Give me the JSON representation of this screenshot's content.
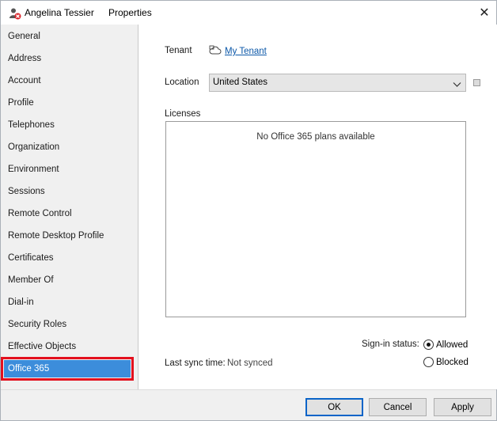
{
  "titlebar": {
    "user_name": "Angelina Tessier",
    "window_title": "Properties",
    "icon": "user-disabled-icon",
    "close_glyph": "✕"
  },
  "sidebar": {
    "items": [
      {
        "label": "General"
      },
      {
        "label": "Address"
      },
      {
        "label": "Account"
      },
      {
        "label": "Profile"
      },
      {
        "label": "Telephones"
      },
      {
        "label": "Organization"
      },
      {
        "label": "Environment"
      },
      {
        "label": "Sessions"
      },
      {
        "label": "Remote Control"
      },
      {
        "label": "Remote Desktop Profile"
      },
      {
        "label": "Certificates"
      },
      {
        "label": "Member Of"
      },
      {
        "label": "Dial-in"
      },
      {
        "label": "Security Roles"
      },
      {
        "label": "Effective Objects"
      },
      {
        "label": "Office 365"
      }
    ],
    "selected": "Office 365"
  },
  "main": {
    "tenant_label": "Tenant",
    "tenant_icon": "cloud-icon",
    "tenant_link": "My Tenant",
    "location_label": "Location",
    "location_value": "United States",
    "licenses_label": "Licenses",
    "licenses_empty": "No Office 365 plans available",
    "sign_in_label": "Sign-in status:",
    "sign_in_options": [
      {
        "label": "Allowed",
        "checked": true
      },
      {
        "label": "Blocked",
        "checked": false
      }
    ],
    "last_sync_label": "Last sync time:",
    "last_sync_value": "Not synced"
  },
  "footer": {
    "ok_label": "OK",
    "cancel_label": "Cancel",
    "apply_label": "Apply"
  },
  "colors": {
    "selection": "#3c8ddb",
    "highlight_border": "#e3101e",
    "link": "#0b57a8"
  }
}
